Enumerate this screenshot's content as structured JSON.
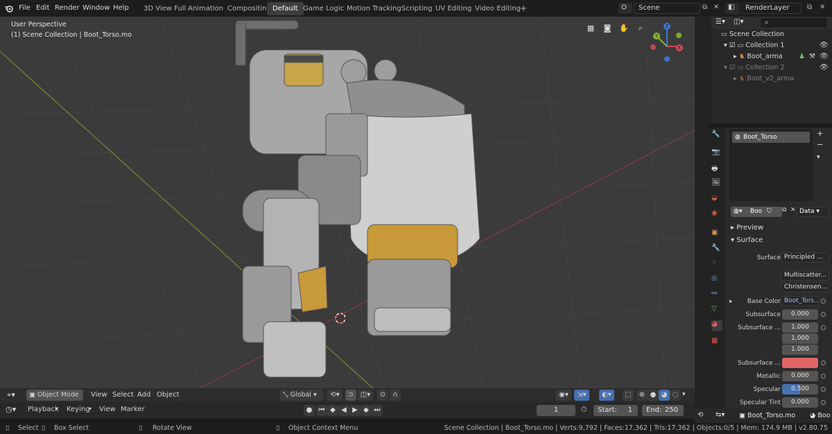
{
  "menu": [
    "File",
    "Edit",
    "Render",
    "Window",
    "Help"
  ],
  "workspaces": [
    "3D View Full",
    "Animation",
    "Compositing",
    "Default",
    "Game Logic",
    "Motion Tracking",
    "Scripting",
    "UV Editing",
    "Video Editing",
    "+"
  ],
  "scene": "Scene",
  "render_layer": "RenderLayer",
  "viewport": {
    "perspective": "User Perspective",
    "collection": "(1) Scene Collection | Boot_Torso.mo",
    "mode": "Object Mode",
    "view": "View",
    "select": "Select",
    "add": "Add",
    "object": "Object",
    "orientation": "Global"
  },
  "gizmo": {
    "z": "Z",
    "y": "Y",
    "x": "X"
  },
  "timeline": {
    "playback": "Playback",
    "keying": "Keying",
    "view": "View",
    "marker": "Marker",
    "frame": "1",
    "start_label": "Start:",
    "start": "1",
    "end_label": "End:",
    "end": "250"
  },
  "outliner": {
    "root": "Scene Collection",
    "items": [
      {
        "label": "Collection 1",
        "indent": 1,
        "dim": false
      },
      {
        "label": "Boot_arma",
        "indent": 2,
        "dim": false
      },
      {
        "label": "Collection 2",
        "indent": 1,
        "dim": true
      },
      {
        "label": "Boot_v2_arma",
        "indent": 2,
        "dim": true
      }
    ]
  },
  "properties": {
    "material_slot": "Boot_Torso",
    "mat_name": "Boo",
    "data_link": "Data",
    "preview": "Preview",
    "surface_panel": "Surface",
    "surface_label": "Surface",
    "surface_value": "Principled ...",
    "dist1": "Multiscatter...",
    "dist2": "Christensen...",
    "base_color_label": "Base Color",
    "base_color_value": "Boot_Tors...",
    "subsurface_label": "Subsurface",
    "subsurface_value": "0.000",
    "subsurface_r_label": "Subsurface ...",
    "subsurface_r": [
      "1.000",
      "1.000",
      "1.000"
    ],
    "subsurface_c_label": "Subsurface ...",
    "subsurface_c_color": "#e06666",
    "metallic_label": "Metallic",
    "metallic_value": "0.000",
    "specular_label": "Specular",
    "specular_value": "0.500",
    "specular_fill": 0.5,
    "spectint_label": "Specular Tint",
    "spectint_value": "0.000",
    "footer_object": "Boot_Torso.mo",
    "footer_right": "Boo"
  },
  "status": {
    "select": "Select",
    "box_select": "Box Select",
    "rotate_view": "Rotate View",
    "context_menu": "Object Context Menu",
    "info": "Scene Collection | Boot_Torso.mo | Verts:9,792 | Faces:17,362 | Tris:17,362 | Objects:0/5 | Mem: 174.9 MB | v2.80.75"
  },
  "colors": {
    "accent": "#4772b3",
    "x_axis": "#d04a5a",
    "y_axis": "#8ab33a",
    "z_axis": "#3d7bd6"
  }
}
